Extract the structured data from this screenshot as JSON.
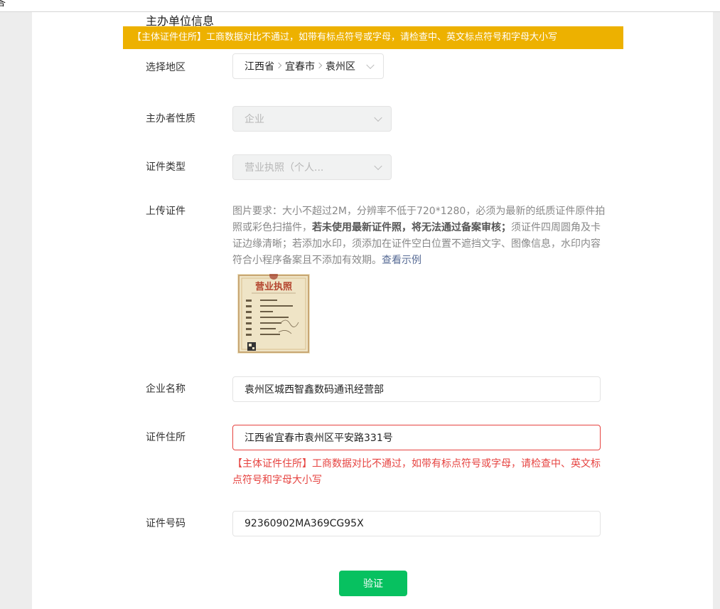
{
  "corner_char": "答",
  "section_title": "主办单位信息",
  "banner_text": "【主体证件住所】工商数据对比不通过，如带有标点符号或字母，请检查中、英文标点符号和字母大小写",
  "region": {
    "label": "选择地区",
    "province": "江西省",
    "city": "宜春市",
    "district": "袁州区"
  },
  "organizer_type": {
    "label": "主办者性质",
    "value": "企业"
  },
  "cert_type": {
    "label": "证件类型",
    "value": "营业执照（个人..."
  },
  "upload": {
    "label": "上传证件",
    "req_part1": "图片要求：大小不超过2M，分辨率不低于720*1280，必须为最新的纸质证件原件拍照或彩色扫描件，",
    "req_bold": "若未使用最新证件照，将无法通过备案审核；",
    "req_part2": "须证件四周圆角及卡证边缘清晰；若添加水印，须添加在证件空白位置不遮挡文字、图像信息，水印内容符合小程序备案且不添加有效期。",
    "req_link": "查看示例",
    "license_title": "营业执照"
  },
  "company_name": {
    "label": "企业名称",
    "value": "袁州区城西智鑫数码通讯经营部"
  },
  "cert_address": {
    "label": "证件住所",
    "value": "江西省宜春市袁州区平安路331号",
    "error": "【主体证件住所】工商数据对比不通过，如带有标点符号或字母，请检查中、英文标点符号和字母大小写"
  },
  "cert_number": {
    "label": "证件号码",
    "value": "92360902MA369CG95X"
  },
  "verify_button": "验证",
  "colors": {
    "banner": "#edb100",
    "error": "#e64340",
    "primary": "#07c160",
    "link": "#576b95"
  }
}
